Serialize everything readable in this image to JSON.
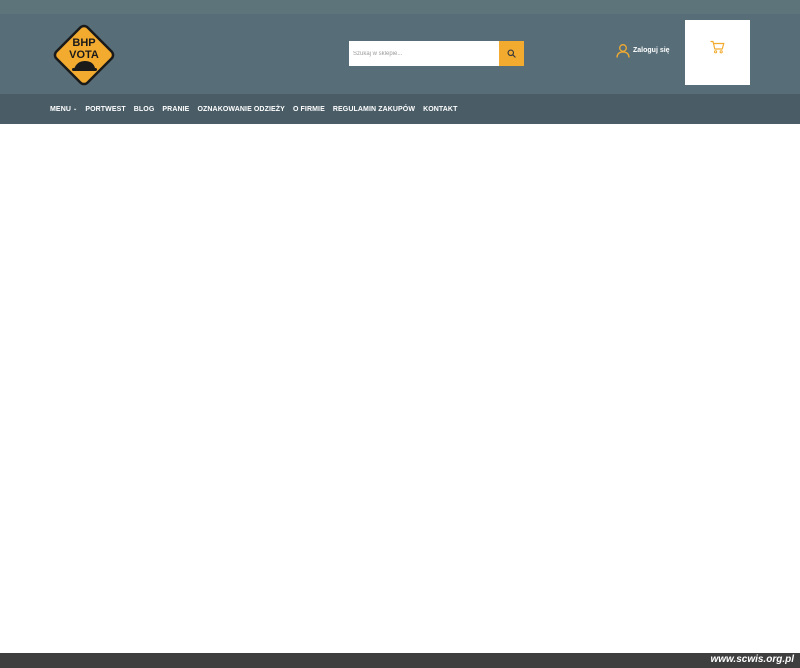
{
  "brand": {
    "logo_line1": "BHP",
    "logo_line2": "VOTA"
  },
  "search": {
    "placeholder": "Szukaj w sklepie...",
    "icon": "search-icon"
  },
  "account": {
    "login_label": "Zaloguj się",
    "icon": "user-icon"
  },
  "cart": {
    "icon": "cart-icon"
  },
  "nav": {
    "items": [
      {
        "label": "MENU",
        "has_dropdown": true
      },
      {
        "label": "PORTWEST"
      },
      {
        "label": "BLOG"
      },
      {
        "label": "PRANIE"
      },
      {
        "label": "OZNAKOWANIE ODZIEŻY"
      },
      {
        "label": "O FIRMIE"
      },
      {
        "label": "REGULAMIN ZAKUPÓW"
      },
      {
        "label": "KONTAKT"
      }
    ]
  },
  "footer": {
    "watermark": "www.scwis.org.pl"
  },
  "colors": {
    "accent": "#f2ab2f",
    "header": "#576e79",
    "navbar": "#4a5d67"
  }
}
